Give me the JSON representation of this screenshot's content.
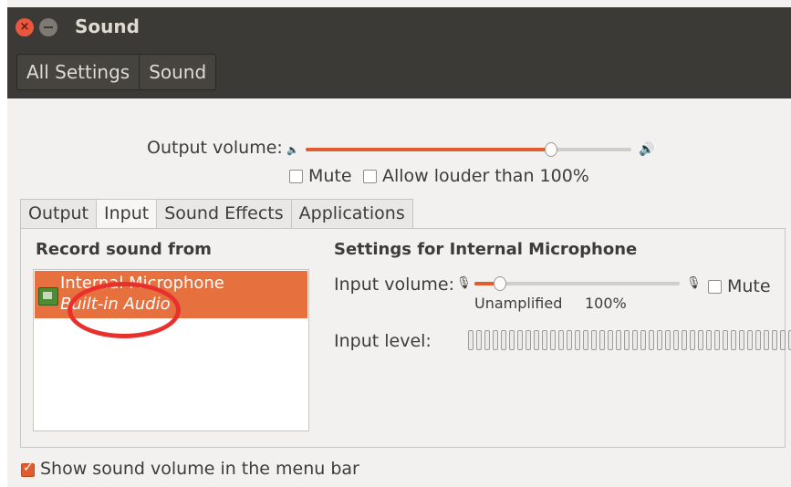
{
  "window": {
    "title": "Sound",
    "close_glyph": "×"
  },
  "breadcrumb": {
    "items": [
      "All Settings",
      "Sound"
    ]
  },
  "output": {
    "volume_label": "Output volume:",
    "volume_level": 0.75,
    "mute_label": "Mute",
    "mute_checked": false,
    "allow_louder_label": "Allow louder than 100%",
    "allow_louder_checked": false
  },
  "tabs": [
    {
      "label": "Output",
      "active": false
    },
    {
      "label": "Input",
      "active": true
    },
    {
      "label": "Sound Effects",
      "active": false
    },
    {
      "label": "Applications",
      "active": false
    }
  ],
  "input_panel": {
    "record_heading": "Record sound from",
    "device": {
      "name": "Internal Microphone",
      "subtitle": "Built-in Audio",
      "selected": true
    },
    "settings_heading": "Settings for Internal Microphone",
    "input_volume_label": "Input volume:",
    "input_volume_level": 0.12,
    "mute_label": "Mute",
    "mute_checked": false,
    "scale_unamplified": "Unamplified",
    "scale_100": "100%",
    "input_level_label": "Input level:"
  },
  "footer": {
    "show_in_menubar_label": "Show sound volume in the menu bar",
    "show_in_menubar_checked": true
  },
  "icons": {
    "speaker_low": "speaker-low-icon",
    "speaker_high": "speaker-high-icon",
    "mic": "microphone-icon"
  },
  "colors": {
    "accent": "#e05d2e",
    "annotation": "#e8302d",
    "titlebar": "#3b3a36"
  }
}
